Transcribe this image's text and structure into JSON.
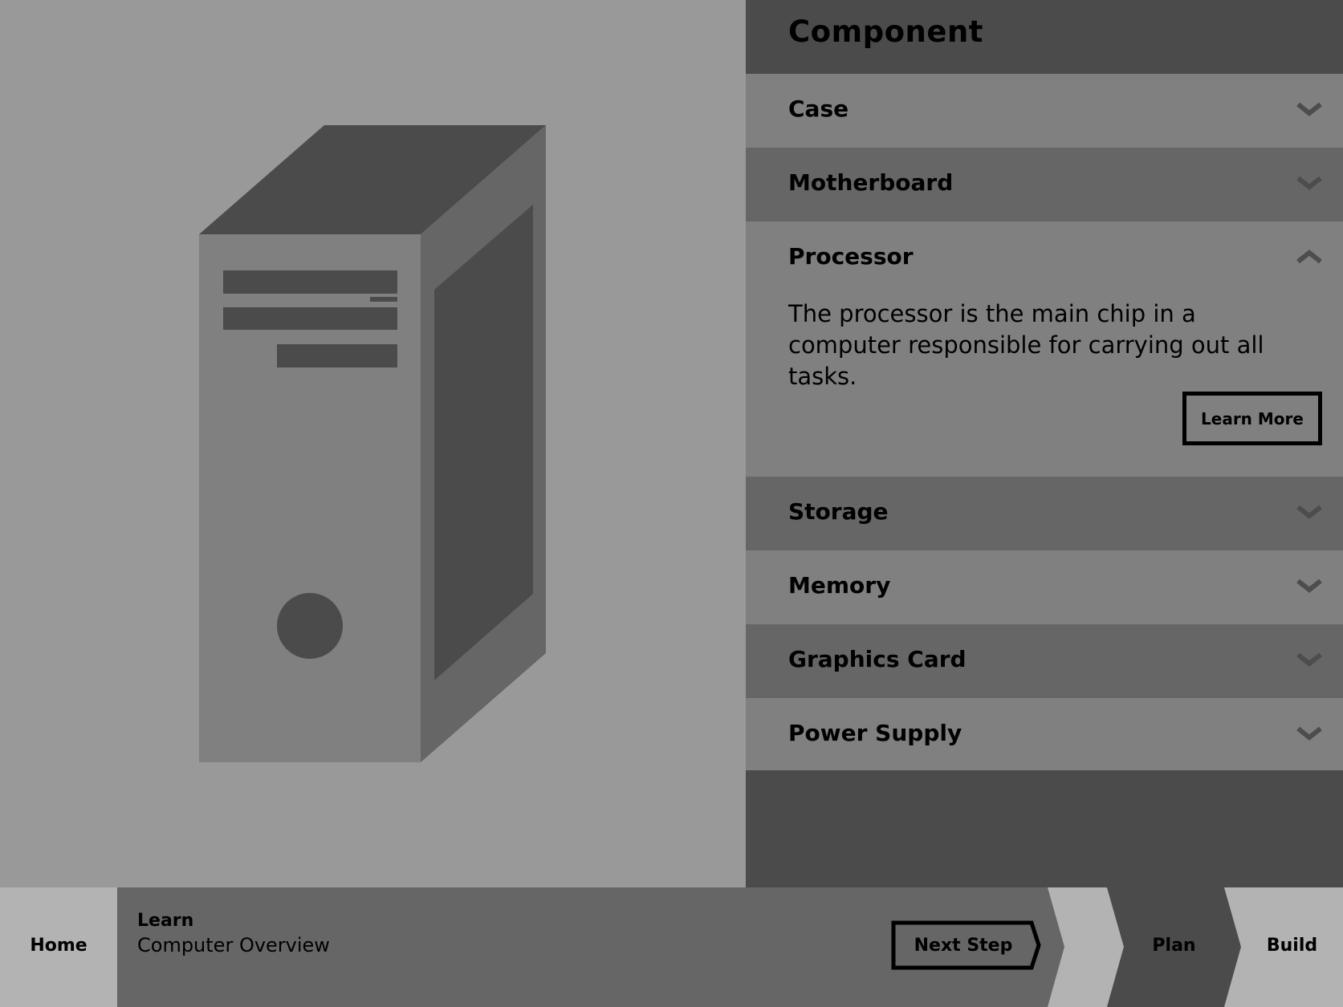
{
  "panel": {
    "title": "Component",
    "items": [
      {
        "label": "Case",
        "expanded": false
      },
      {
        "label": "Motherboard",
        "expanded": false
      },
      {
        "label": "Processor",
        "expanded": true,
        "description": "The processor is the main chip in a computer responsible for carrying out all tasks.",
        "button_label": "Learn More"
      },
      {
        "label": "Storage",
        "expanded": false
      },
      {
        "label": "Memory",
        "expanded": false
      },
      {
        "label": "Graphics Card",
        "expanded": false
      },
      {
        "label": "Power Supply",
        "expanded": false
      }
    ]
  },
  "bottombar": {
    "home_label": "Home",
    "section_title": "Learn",
    "section_subtitle": "Computer Overview",
    "next_step_label": "Next Step",
    "steps": [
      "Plan",
      "Build"
    ]
  },
  "icons": {
    "collapsed": "chevron-down-icon",
    "expanded": "chevron-up-icon",
    "illustration": "computer-tower"
  },
  "colors": {
    "viewer_bg": "#999999",
    "panel_bg": "#4b4b4b",
    "row_light": "#808080",
    "row_dark": "#666666",
    "chevron": "#4d4d4d",
    "nav_light": "#b3b3b3",
    "nav_dark": "#4b4b4b"
  }
}
